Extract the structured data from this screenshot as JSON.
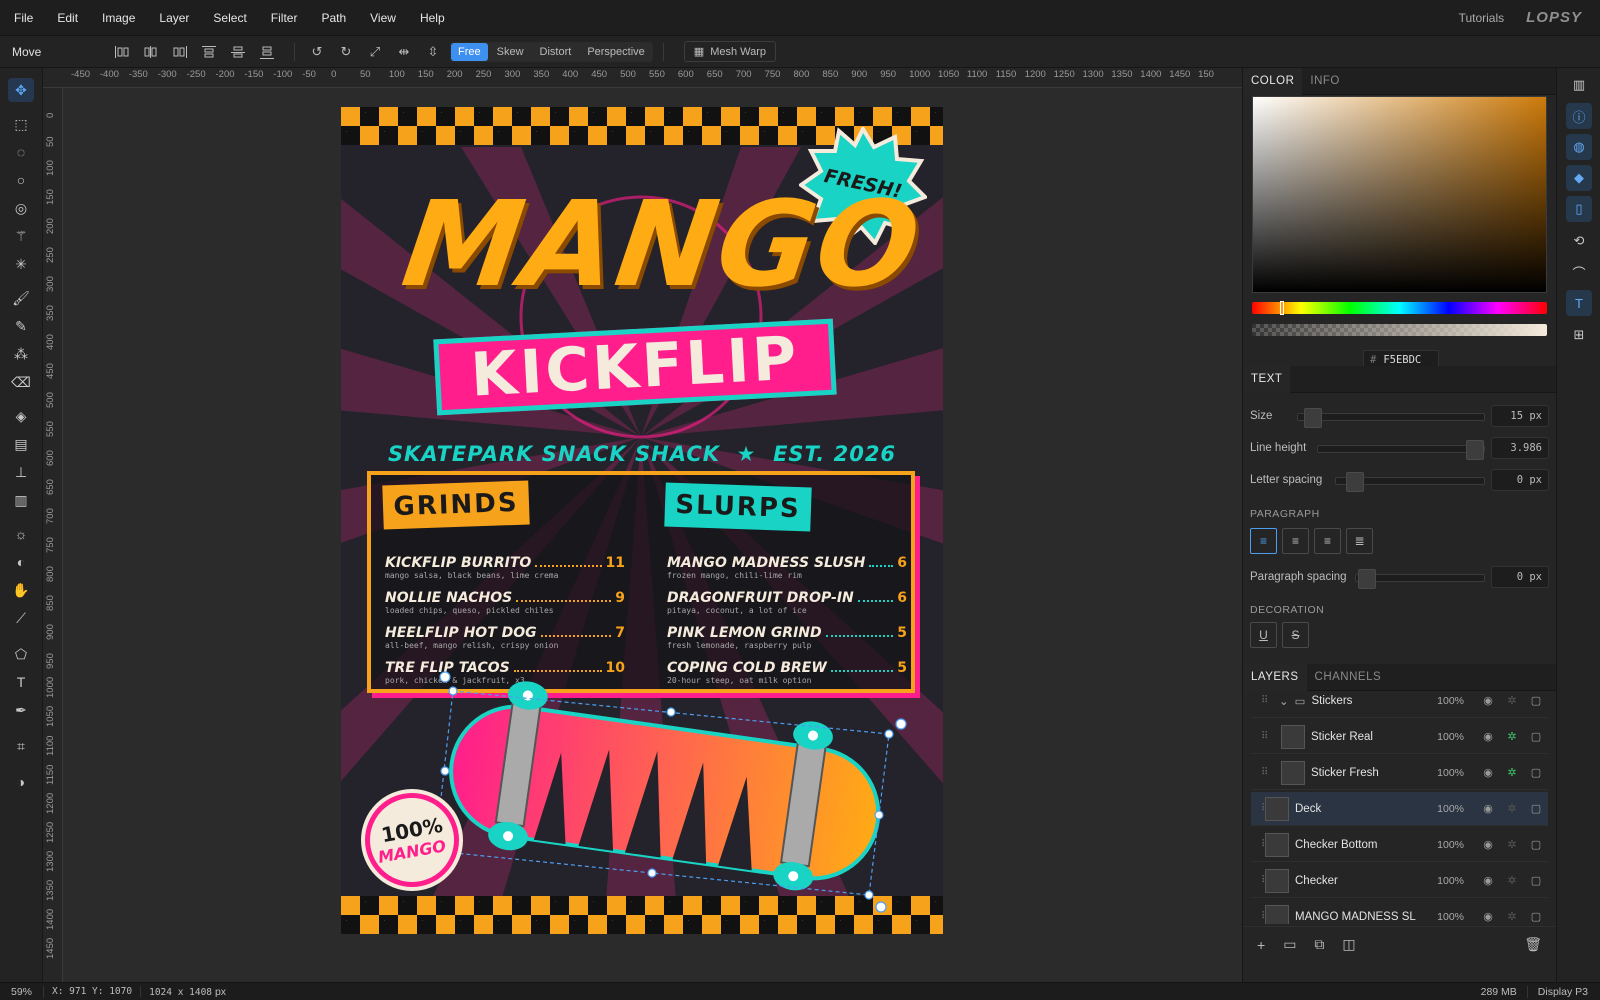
{
  "menu": [
    "File",
    "Edit",
    "Image",
    "Layer",
    "Select",
    "Filter",
    "Path",
    "View",
    "Help"
  ],
  "menu_right": {
    "tutorials": "Tutorials",
    "logo": "LOPSY"
  },
  "options": {
    "tool_name": "Move",
    "transform_modes": [
      "Free",
      "Skew",
      "Distort",
      "Perspective"
    ],
    "active_mode": "Free",
    "mesh_warp": "Mesh Warp"
  },
  "ruler_top": [
    "-450",
    "-400",
    "-350",
    "-300",
    "-250",
    "-200",
    "-150",
    "-100",
    "-50",
    "0",
    "50",
    "100",
    "150",
    "200",
    "250",
    "300",
    "350",
    "400",
    "450",
    "500",
    "550",
    "600",
    "650",
    "700",
    "750",
    "800",
    "850",
    "900",
    "950",
    "1000",
    "1050",
    "1100",
    "1150",
    "1200",
    "1250",
    "1300",
    "1350",
    "1400",
    "1450",
    "150"
  ],
  "ruler_left": [
    "0",
    "50",
    "100",
    "150",
    "200",
    "250",
    "300",
    "350",
    "400",
    "450",
    "500",
    "550",
    "600",
    "650",
    "700",
    "750",
    "800",
    "850",
    "900",
    "950",
    "1000",
    "1050",
    "1100",
    "1150",
    "1200",
    "1250",
    "1300",
    "1350",
    "1400",
    "1450"
  ],
  "poster": {
    "title": "MANGO",
    "subtitle": "KICKFLIP",
    "tagline": "SKATEPARK SNACK SHACK  ★  EST. 2026",
    "fresh": "FRESH!",
    "badge_top": "100%",
    "badge_bottom": "MANGO",
    "grinds_header": "GRINDS",
    "slurps_header": "SLURPS",
    "grinds": [
      {
        "name": "KICKFLIP BURRITO",
        "price": "11",
        "desc": "mango salsa, black beans, lime crema"
      },
      {
        "name": "NOLLIE NACHOS",
        "price": "9",
        "desc": "loaded chips, queso, pickled chiles"
      },
      {
        "name": "HEELFLIP HOT DOG",
        "price": "7",
        "desc": "all-beef, mango relish, crispy onion"
      },
      {
        "name": "TRE FLIP TACOS",
        "price": "10",
        "desc": "pork, chicken & jackfruit, x3"
      }
    ],
    "slurps": [
      {
        "name": "MANGO MADNESS SLUSH",
        "price": "6",
        "desc": "frozen mango, chili-lime rim"
      },
      {
        "name": "DRAGONFRUIT DROP-IN",
        "price": "6",
        "desc": "pitaya, coconut, a lot of ice"
      },
      {
        "name": "PINK LEMON GRIND",
        "price": "5",
        "desc": "fresh lemonade, raspberry pulp"
      },
      {
        "name": "COPING COLD BREW",
        "price": "5",
        "desc": "20-hour steep, oat milk option"
      }
    ]
  },
  "panel_tabs": {
    "color": "COLOR",
    "info": "INFO",
    "text": "TEXT",
    "layers": "LAYERS",
    "channels": "CHANNELS"
  },
  "color": {
    "hash": "#",
    "hex": "F5EBDC"
  },
  "text_panel": {
    "size_label": "Size",
    "size_value": "15 px",
    "lh_label": "Line height",
    "lh_value": "3.986",
    "ls_label": "Letter spacing",
    "ls_value": "0 px",
    "paragraph": "PARAGRAPH",
    "ps_label": "Paragraph spacing",
    "ps_value": "0 px",
    "decoration": "DECORATION",
    "underline": "U",
    "strike": "S"
  },
  "layers": [
    {
      "name": "Stickers",
      "opacity": "100%"
    },
    {
      "name": "Sticker Real",
      "opacity": "100%"
    },
    {
      "name": "Sticker Fresh",
      "opacity": "100%"
    },
    {
      "name": "Deck",
      "opacity": "100%",
      "selected": true
    },
    {
      "name": "Checker Bottom",
      "opacity": "100%"
    },
    {
      "name": "Checker",
      "opacity": "100%"
    },
    {
      "name": "MANGO MADNESS SL",
      "opacity": "100%"
    }
  ],
  "status": {
    "zoom": "59%",
    "coords_label": "X: 971 Y: ",
    "coords_y": "1070",
    "dims": "1024 x 1408",
    "dims_unit": "px",
    "memory": "289 MB",
    "display": "Display P3"
  },
  "colors": {
    "accent": "#3d8ff0",
    "mango": "#f7a21b",
    "pink": "#ff1e8c",
    "teal": "#19d3c5",
    "cream": "#f5ebdc"
  }
}
